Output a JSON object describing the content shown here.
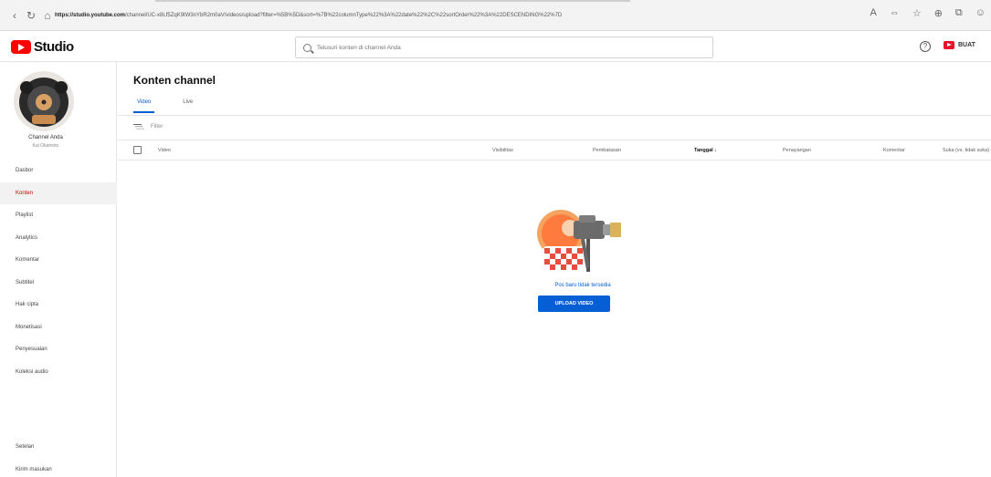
{
  "browser": {
    "url_host": "https://studio.youtube.com",
    "url_rest": "/channel/UC-x8Lf5ZqK9tW3nYbR2m0aV/videos/upload?filter=%5B%5D&sort=%7B%22columnType%22%3A%22date%22%2C%22sortOrder%22%3A%22DESCENDING%22%7D"
  },
  "header": {
    "logo_text": "Studio",
    "search_placeholder": "Telusuri konten di channel Anda",
    "create_label": "BUAT"
  },
  "sidebar": {
    "channel_name": "Channel Anda",
    "channel_sub": "Kai Okamoto",
    "items": [
      {
        "label": "Dasbor"
      },
      {
        "label": "Konten",
        "active": true
      },
      {
        "label": "Playlist"
      },
      {
        "label": "Analytics"
      },
      {
        "label": "Komentar"
      },
      {
        "label": "Subtitel"
      },
      {
        "label": "Hak cipta"
      },
      {
        "label": "Monetisasi"
      },
      {
        "label": "Penyesuaian"
      },
      {
        "label": "Koleksi audio"
      }
    ],
    "bottom_items": [
      {
        "label": "Setelan"
      },
      {
        "label": "Kirim masukan"
      }
    ]
  },
  "main": {
    "title": "Konten channel",
    "tabs": [
      {
        "label": "Video",
        "active": true
      },
      {
        "label": "Live"
      }
    ],
    "filter_label": "Filter",
    "columns": [
      {
        "label": "Video"
      },
      {
        "label": "Visibilitas"
      },
      {
        "label": "Pembatasan"
      },
      {
        "label": "Tanggal ↓",
        "sorted": true
      },
      {
        "label": "Penayangan"
      },
      {
        "label": "Komentar"
      },
      {
        "label": "Suka (vs. tidak suka)"
      }
    ],
    "empty_text": "Pos baru tidak tersedia",
    "upload_label": "UPLOAD VIDEO"
  },
  "colors": {
    "accent": "#065fd4",
    "brand": "#ff0000",
    "active_nav": "#cc0000"
  }
}
